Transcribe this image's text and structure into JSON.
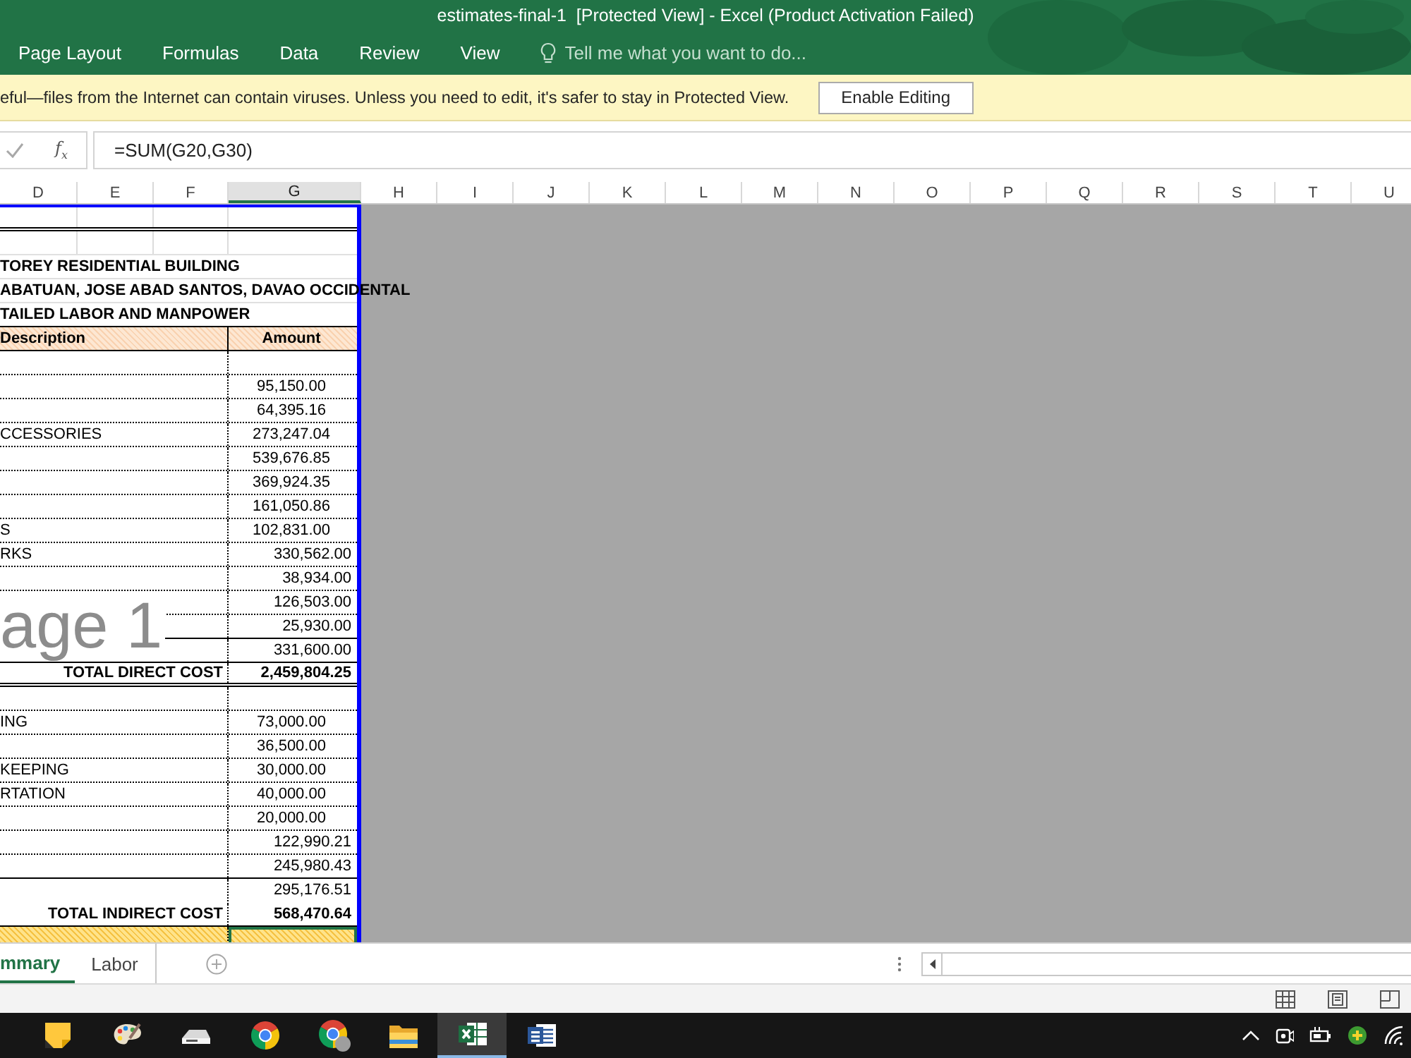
{
  "window": {
    "title": "estimates-final-1  [Protected View] - Excel (Product Activation Failed)"
  },
  "ribbon": {
    "tabs": [
      {
        "label": "Page Layout",
        "selected": false
      },
      {
        "label": "Formulas",
        "selected": false
      },
      {
        "label": "Data",
        "selected": false
      },
      {
        "label": "Review",
        "selected": false
      },
      {
        "label": "View",
        "selected": false
      }
    ],
    "tell_me": {
      "placeholder": "Tell me what you want to do..."
    }
  },
  "protected_view": {
    "message": "eful—files from the Internet can contain viruses. Unless you need to edit, it's safer to stay in Protected View.",
    "button": "Enable Editing"
  },
  "formula_bar": {
    "function_label": "f$_{x}$",
    "formula": "=SUM(G20,G30)"
  },
  "columns": [
    {
      "label": "D",
      "selected": false
    },
    {
      "label": "E",
      "selected": false
    },
    {
      "label": "F",
      "selected": false
    },
    {
      "label": "G",
      "selected": true
    },
    {
      "label": "H",
      "selected": false
    },
    {
      "label": "I",
      "selected": false
    },
    {
      "label": "J",
      "selected": false
    },
    {
      "label": "K",
      "selected": false
    },
    {
      "label": "L",
      "selected": false
    },
    {
      "label": "M",
      "selected": false
    },
    {
      "label": "N",
      "selected": false
    },
    {
      "label": "O",
      "selected": false
    },
    {
      "label": "P",
      "selected": false
    },
    {
      "label": "Q",
      "selected": false
    },
    {
      "label": "R",
      "selected": false
    },
    {
      "label": "S",
      "selected": false
    },
    {
      "label": "T",
      "selected": false
    },
    {
      "label": "U",
      "selected": false
    }
  ],
  "sheet": {
    "page_label": "age 1",
    "rows": [
      {
        "kind": "blank",
        "rule": {
          "kind": "double"
        },
        "selected": false
      },
      {
        "kind": "blank",
        "rule": {
          "kind": "grid"
        },
        "selected": false
      },
      {
        "kind": "title",
        "description": "TOREY RESIDENTIAL BUILDING",
        "rule": {
          "kind": "grid"
        },
        "selected": false
      },
      {
        "kind": "title",
        "description": "ABATUAN, JOSE ABAD SANTOS, DAVAO OCCIDENTAL",
        "rule": {
          "kind": "grid"
        },
        "selected": false
      },
      {
        "kind": "title",
        "description": "TAILED LABOR AND MANPOWER",
        "rule": {
          "kind": "solid"
        },
        "selected": false
      },
      {
        "kind": "header",
        "description": "Description",
        "amount": "Amount",
        "centered": true,
        "rule": {
          "kind": "solid"
        },
        "selected": false
      },
      {
        "kind": "item",
        "rule": {
          "kind": "dotted"
        },
        "selected": false
      },
      {
        "kind": "item",
        "amount": "95,150.00",
        "centered": true,
        "rule": {
          "kind": "dotted"
        },
        "selected": false
      },
      {
        "kind": "item",
        "amount": "64,395.16",
        "centered": true,
        "rule": {
          "kind": "dotted"
        },
        "selected": false
      },
      {
        "kind": "item",
        "description": "CCESSORIES",
        "amount": "273,247.04",
        "centered": true,
        "rule": {
          "kind": "dotted"
        },
        "selected": false
      },
      {
        "kind": "item",
        "amount": "539,676.85",
        "centered": true,
        "rule": {
          "kind": "dotted"
        },
        "selected": false
      },
      {
        "kind": "item",
        "amount": "369,924.35",
        "centered": true,
        "rule": {
          "kind": "dotted"
        },
        "selected": false
      },
      {
        "kind": "item",
        "amount": "161,050.86",
        "centered": true,
        "rule": {
          "kind": "dotted"
        },
        "selected": false
      },
      {
        "kind": "item",
        "description": "S",
        "amount": "102,831.00",
        "centered": true,
        "rule": {
          "kind": "dotted"
        },
        "selected": false
      },
      {
        "kind": "item",
        "description": "RKS",
        "amount": "330,562.00",
        "centered": false,
        "rule": {
          "kind": "dotted"
        },
        "selected": false
      },
      {
        "kind": "item",
        "amount": "38,934.00",
        "centered": false,
        "rule": {
          "kind": "dotted"
        },
        "selected": false
      },
      {
        "kind": "item",
        "amount": "126,503.00",
        "centered": false,
        "rule": {
          "kind": "dotted"
        },
        "selected": false
      },
      {
        "kind": "item",
        "amount": "25,930.00",
        "centered": false,
        "rule": {
          "kind": "solid"
        },
        "selected": false
      },
      {
        "kind": "item",
        "amount": "331,600.00",
        "centered": false,
        "rule": {
          "kind": "solid"
        },
        "selected": false
      },
      {
        "kind": "total",
        "description": "TOTAL DIRECT COST",
        "amount": "2,459,804.25",
        "centered": false,
        "rule": {
          "kind": "double"
        },
        "selected": false
      },
      {
        "kind": "item",
        "rule": {
          "kind": "dotted"
        },
        "selected": false
      },
      {
        "kind": "item",
        "description": "ING",
        "amount": "73,000.00",
        "centered": true,
        "rule": {
          "kind": "dotted"
        },
        "selected": false
      },
      {
        "kind": "item",
        "amount": "36,500.00",
        "centered": true,
        "rule": {
          "kind": "dotted"
        },
        "selected": false
      },
      {
        "kind": "item",
        "description": "KEEPING",
        "amount": "30,000.00",
        "centered": true,
        "rule": {
          "kind": "dotted"
        },
        "selected": false
      },
      {
        "kind": "item",
        "description": "RTATION",
        "amount": "40,000.00",
        "centered": true,
        "rule": {
          "kind": "dotted"
        },
        "selected": false
      },
      {
        "kind": "item",
        "amount": "20,000.00",
        "centered": true,
        "rule": {
          "kind": "dotted"
        },
        "selected": false
      },
      {
        "kind": "item",
        "amount": "122,990.21",
        "centered": false,
        "rule": {
          "kind": "dotted"
        },
        "selected": false
      },
      {
        "kind": "item",
        "amount": "245,980.43",
        "centered": false,
        "rule": {
          "kind": "solid"
        },
        "selected": false
      },
      {
        "kind": "item",
        "amount": "295,176.51",
        "centered": false,
        "rule": {
          "kind": "none"
        },
        "selected": false
      },
      {
        "kind": "total",
        "description": "TOTAL INDIRECT COST",
        "amount": "568,470.64",
        "centered": false,
        "rule": {
          "kind": "solid"
        },
        "selected": false
      },
      {
        "kind": "grand",
        "rule": {
          "kind": "solid"
        },
        "selected": true
      }
    ]
  },
  "sheet_tabs": [
    {
      "label": "mmary",
      "selected": true
    },
    {
      "label": "Labor",
      "selected": false
    }
  ],
  "taskbar": {
    "apps": [
      {
        "selected": false
      },
      {
        "selected": false
      },
      {
        "selected": false
      },
      {
        "selected": false
      },
      {
        "selected": false
      },
      {
        "selected": false
      },
      {
        "selected": true
      },
      {
        "selected": false
      }
    ]
  }
}
